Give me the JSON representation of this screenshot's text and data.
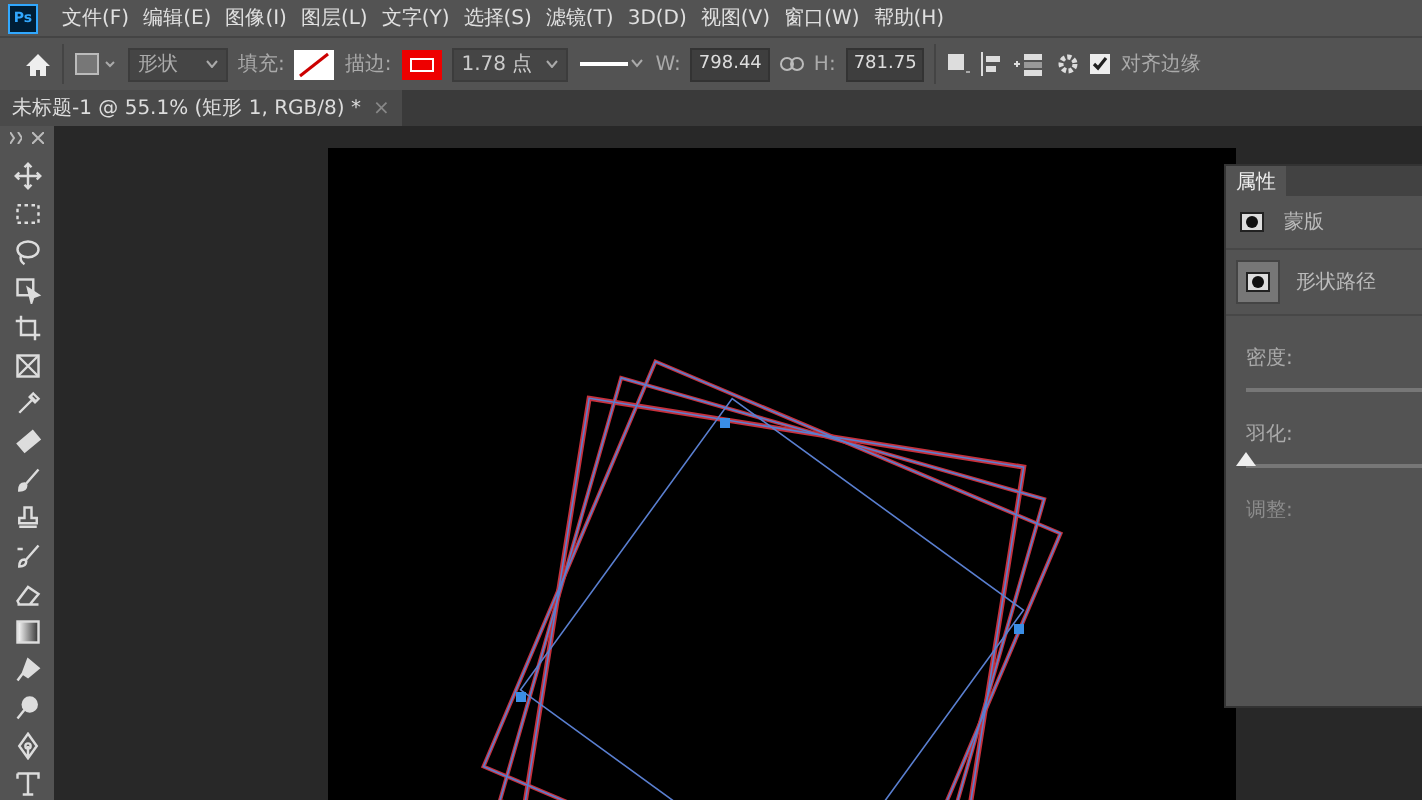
{
  "menu_bar": {
    "app_badge": "Ps",
    "items": [
      "文件(F)",
      "编辑(E)",
      "图像(I)",
      "图层(L)",
      "文字(Y)",
      "选择(S)",
      "滤镜(T)",
      "3D(D)",
      "视图(V)",
      "窗口(W)",
      "帮助(H)"
    ]
  },
  "options_bar": {
    "shape_mode": "形状",
    "fill_label": "填充:",
    "stroke_label": "描边:",
    "stroke_width": "1.78 点",
    "w_label": "W:",
    "w_value": "798.44",
    "h_label": "H:",
    "h_value": "781.75",
    "align_edges": {
      "label": "对齐边缘",
      "checked": true
    }
  },
  "document_tab": {
    "title": "未标题-1 @ 55.1% (矩形 1, RGB/8) *",
    "close": "×"
  },
  "toolbar": {
    "tools": [
      {
        "kind": "move"
      },
      {
        "kind": "marquee"
      },
      {
        "kind": "lasso"
      },
      {
        "kind": "object-select"
      },
      {
        "kind": "crop"
      },
      {
        "kind": "frame"
      },
      {
        "kind": "eyedropper"
      },
      {
        "kind": "healing"
      },
      {
        "kind": "brush"
      },
      {
        "kind": "stamp"
      },
      {
        "kind": "history-brush"
      },
      {
        "kind": "eraser"
      },
      {
        "kind": "gradient"
      },
      {
        "kind": "blur"
      },
      {
        "kind": "dodge"
      },
      {
        "kind": "pen"
      },
      {
        "kind": "type"
      }
    ]
  },
  "properties_panel": {
    "title": "属性",
    "sections": [
      {
        "label": "蒙版",
        "selected": false
      },
      {
        "label": "形状路径",
        "selected": true
      }
    ],
    "fields": [
      {
        "label": "密度:",
        "disabled": false
      },
      {
        "label": "羽化:",
        "disabled": false,
        "level": 0
      },
      {
        "label": "调整:",
        "disabled": true
      }
    ]
  }
}
